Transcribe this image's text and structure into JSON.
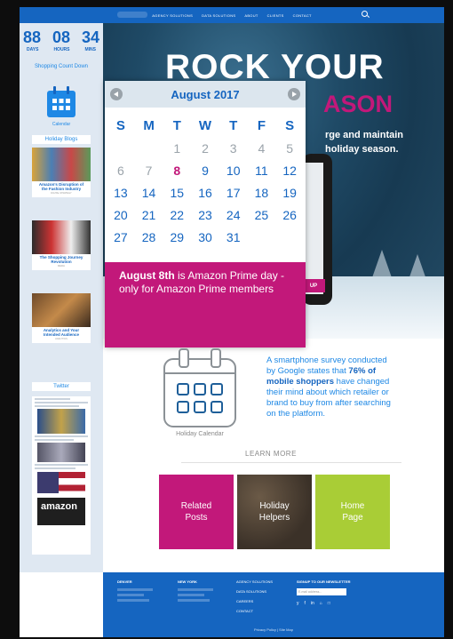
{
  "nav": {
    "items": [
      "AGENCY SOLUTIONS",
      "DATA SOLUTIONS",
      "ABOUT",
      "CLIENTS",
      "CONTACT"
    ]
  },
  "countdown": {
    "days": "88",
    "hours": "08",
    "mins": "34",
    "days_label": "DAYS",
    "hours_label": "HOURS",
    "mins_label": "MINS",
    "title": "Shopping Count Down"
  },
  "sidebar": {
    "calendar_label": "Calendar",
    "blogs_heading": "Holiday Blogs",
    "blogs": [
      {
        "title": "Amazon's Disruption of the Fashion Industry",
        "tag": "DIGITAL STRATEGY"
      },
      {
        "title": "The Shopping Journey Revolution",
        "tag": "MEDIA"
      },
      {
        "title": "Analytics and Your Intended Audience",
        "tag": "ANALYTICS"
      }
    ],
    "twitter_heading": "Twitter",
    "amazon_text": "amazon"
  },
  "hero": {
    "title_line1": "ROCK YOUR",
    "title_line2": "ASON",
    "subtitle_line1": "rge and maintain",
    "subtitle_line2": "holiday season.",
    "phone_button": "UP"
  },
  "calendar": {
    "month": "August 2017",
    "weekdays": [
      "S",
      "M",
      "T",
      "W",
      "T",
      "F",
      "S"
    ],
    "days": [
      "",
      "",
      "1",
      "2",
      "3",
      "4",
      "5",
      "6",
      "7",
      "8",
      "9",
      "10",
      "11",
      "12",
      "13",
      "14",
      "15",
      "16",
      "17",
      "18",
      "19",
      "20",
      "21",
      "22",
      "23",
      "24",
      "25",
      "26",
      "27",
      "28",
      "29",
      "30",
      "31"
    ],
    "highlight_day": "8",
    "note_bold": "August 8th",
    "note_text": " is Amazon Prime day - only for Amazon Prime members"
  },
  "content": {
    "holiday_calendar_label": "Holiday Calendar",
    "survey_text1": "A smartphone survey conducted by Google states that ",
    "survey_bold": "76% of mobile shoppers",
    "survey_text2": " have changed their mind about which retailer or brand to buy from after searching on the platform.",
    "learn_more": "LEARN MORE",
    "tiles": [
      "Related Posts",
      "Holiday Helpers",
      "Home Page"
    ]
  },
  "footer": {
    "col1_heading": "DENVER",
    "col2_heading": "NEW YORK",
    "links": [
      "AGENCY SOLUTIONS",
      "DATA SOLUTIONS",
      "CAREERS",
      "CONTACT"
    ],
    "newsletter_heading": "SIGNUP TO OUR NEWSLETTER",
    "newsletter_placeholder": "E-mail address...",
    "social": [
      "y",
      "f",
      "in",
      "⌂",
      "□"
    ],
    "bottom": "Privacy Policy | Site Map"
  },
  "colors": {
    "brand_blue": "#1565c0",
    "accent_magenta": "#c2187a",
    "accent_green": "#a9cd36"
  }
}
